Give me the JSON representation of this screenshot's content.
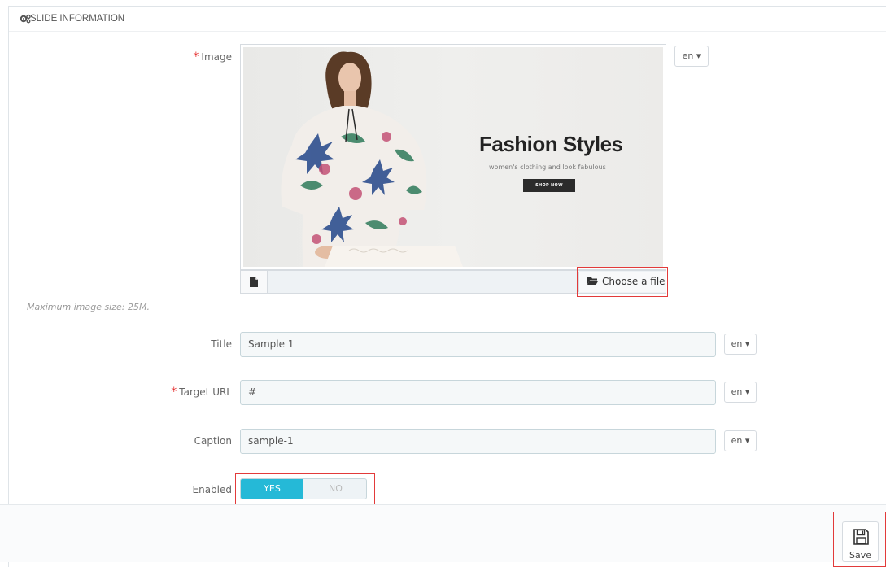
{
  "panel": {
    "title": "SLIDE INFORMATION",
    "icon": "cogs-icon"
  },
  "image_field": {
    "label": "Image",
    "required_mark": "*",
    "lang": "en",
    "promo": {
      "title": "Fashion Styles",
      "subtitle": "women's clothing and look fabulous",
      "button": "SHOP NOW"
    },
    "choose_label": "Choose a file",
    "hint": "Maximum image size: 25M."
  },
  "title_field": {
    "label": "Title",
    "value": "Sample 1",
    "lang": "en"
  },
  "target_url_field": {
    "label": "Target URL",
    "required_mark": "*",
    "value": "#",
    "lang": "en"
  },
  "caption_field": {
    "label": "Caption",
    "value": "sample-1",
    "lang": "en"
  },
  "enabled_field": {
    "label": "Enabled",
    "yes": "YES",
    "no": "NO",
    "selected": "YES"
  },
  "footer": {
    "save_label": "Save"
  },
  "colors": {
    "accent": "#25b9d7",
    "highlight": "#e23a3a",
    "required": "#e42b2b"
  }
}
